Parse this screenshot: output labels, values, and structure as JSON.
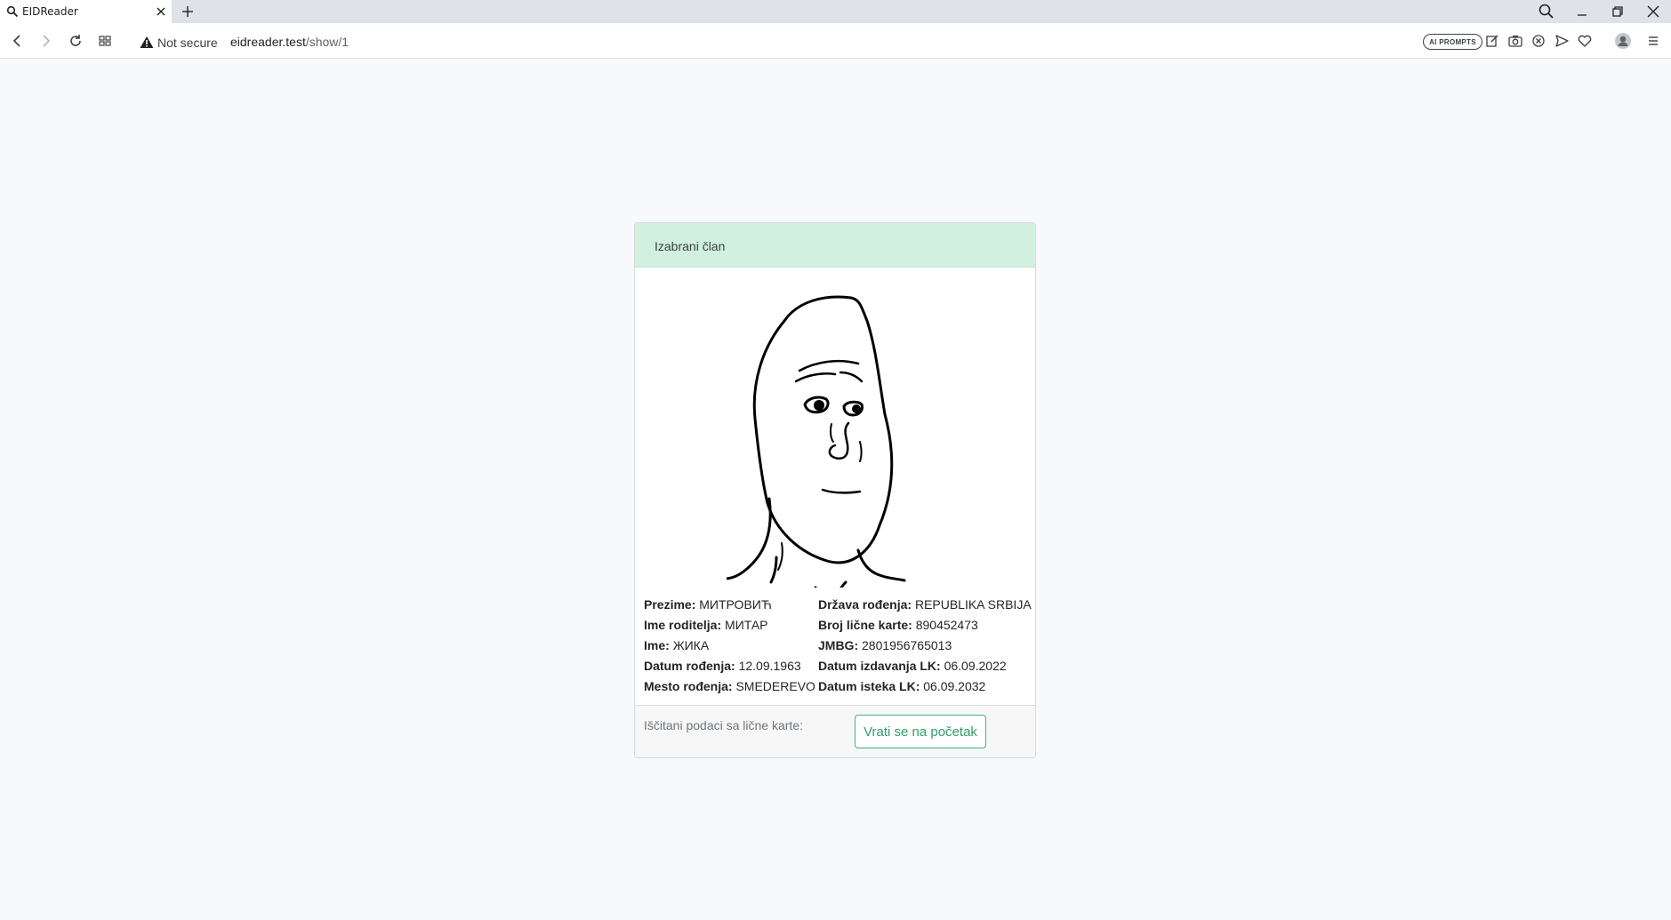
{
  "browser": {
    "tab_title": "EIDReader",
    "security_label": "Not secure",
    "url_host": "eidreader.test",
    "url_path": "/show/1",
    "ai_badge": "AI PROMPTS"
  },
  "card": {
    "header": "Izabrani član",
    "left_fields": [
      {
        "label": "Prezime:",
        "value": "МИТРОВИЋ"
      },
      {
        "label": "Ime roditelja:",
        "value": "МИТАР"
      },
      {
        "label": "Ime:",
        "value": "ЖИКА"
      },
      {
        "label": "Datum rođenja:",
        "value": "12.09.1963"
      },
      {
        "label": "Mesto rođenja:",
        "value": "SMEDEREVO"
      }
    ],
    "right_fields": [
      {
        "label": "Država rođenja:",
        "value": "REPUBLIKA SRBIJA"
      },
      {
        "label": "Broj lične karte:",
        "value": "890452473"
      },
      {
        "label": "JMBG:",
        "value": "2801956765013"
      },
      {
        "label": "Datum izdavanja LK:",
        "value": "06.09.2022"
      },
      {
        "label": "Datum isteka LK:",
        "value": "06.09.2032"
      }
    ],
    "footer_text": "Iščitani podaci sa lične karte:",
    "back_button": "Vrati se na početak"
  },
  "colors": {
    "page_background": "#f8f9fa",
    "header_background": "#d1f0e0",
    "button_accent": "#3fb47a"
  }
}
